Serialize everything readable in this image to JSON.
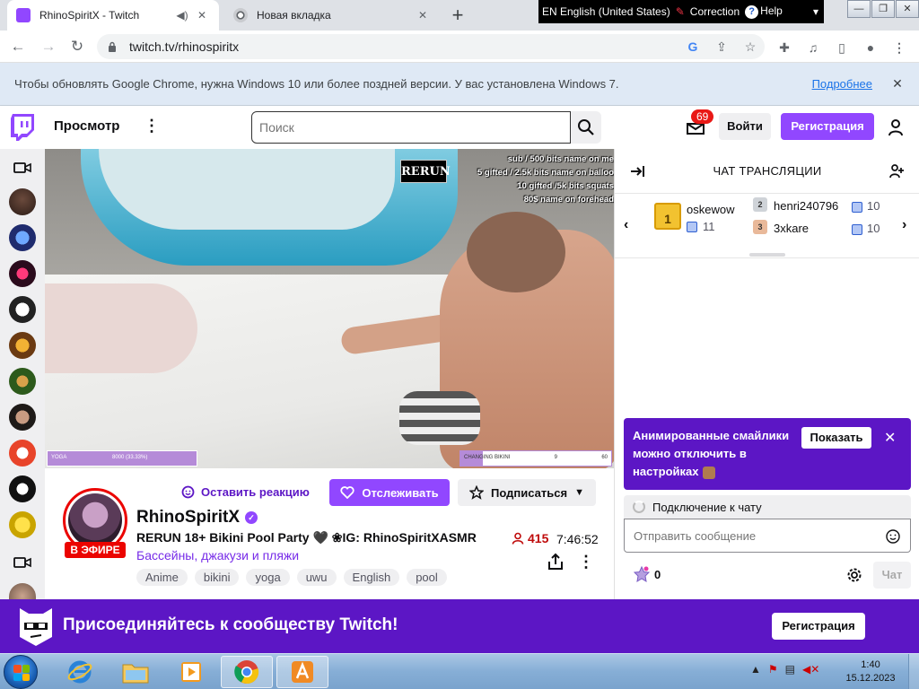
{
  "browser": {
    "tabs": [
      {
        "title": "RhinoSpiritX - Twitch",
        "active": true
      },
      {
        "title": "Новая вкладка",
        "active": false
      }
    ],
    "new_tab": "+",
    "url": "twitch.tv/rhinospiritx"
  },
  "language_bar": {
    "language": "EN English (United States)",
    "correction": "Correction",
    "help": "Help"
  },
  "infobar": {
    "message": "Чтобы обновлять Google Chrome, нужна Windows 10 или более поздней версии. У вас установлена Windows 7.",
    "link": "Подробнее",
    "close": "✕"
  },
  "twitch_nav": {
    "browse": "Просмотр",
    "search_placeholder": "Поиск",
    "notifications_count": "69",
    "login": "Войти",
    "signup": "Регистрация"
  },
  "video_overlay": {
    "rerun_badge": "RERUN",
    "goal_lines": [
      "sub / 500 bits name on me",
      "5 gifted / 2.5k bits name on balloo",
      "10 gifted /5k bits squats",
      "80$ name on forehead"
    ],
    "goal_left": {
      "label": "YOGA",
      "value": "8000 (33.33%)"
    },
    "goal_right": {
      "label": "CHANGING BIKINI",
      "current": "9",
      "target": "60",
      "progress": 0.15
    }
  },
  "channel": {
    "react_label": "Оставить реакцию",
    "follow_label": "Отслеживать",
    "subscribe_label": "Подписаться",
    "live_label": "В ЭФИРЕ",
    "name": "RhinoSpiritX",
    "stream_title": "RERUN 18+ Bikini Pool Party 🖤 ❀IG: RhinoSpiritXASMR",
    "category": "Бассейны, джакузи и пляжи",
    "viewers": "415",
    "uptime": "7:46:52",
    "tags": [
      "Anime",
      "bikini",
      "yoga",
      "uwu",
      "English",
      "pool"
    ]
  },
  "chat": {
    "title": "ЧАТ ТРАНСЛЯЦИИ",
    "leaderboard": [
      {
        "rank": "1",
        "name": "oskewow",
        "count": "11"
      },
      {
        "rank": "2",
        "name": "henri240796",
        "count": "10"
      },
      {
        "rank": "3",
        "name": "3xkare",
        "count": "10"
      }
    ],
    "emote_notice": "Анимированные смайлики можно отключить в настройках",
    "emote_show": "Показать",
    "connecting": "Подключение к чату",
    "input_placeholder": "Отправить сообщение",
    "points": "0",
    "send_label": "Чат"
  },
  "join_banner": {
    "text": "Присоединяйтесь к сообществу Twitch!",
    "button": "Регистрация"
  },
  "taskbar": {
    "time": "1:40",
    "date": "15.12.2023"
  },
  "colors": {
    "twitch_purple": "#9147ff",
    "banner_purple": "#5c16c5",
    "live_red": "#eb0400"
  }
}
